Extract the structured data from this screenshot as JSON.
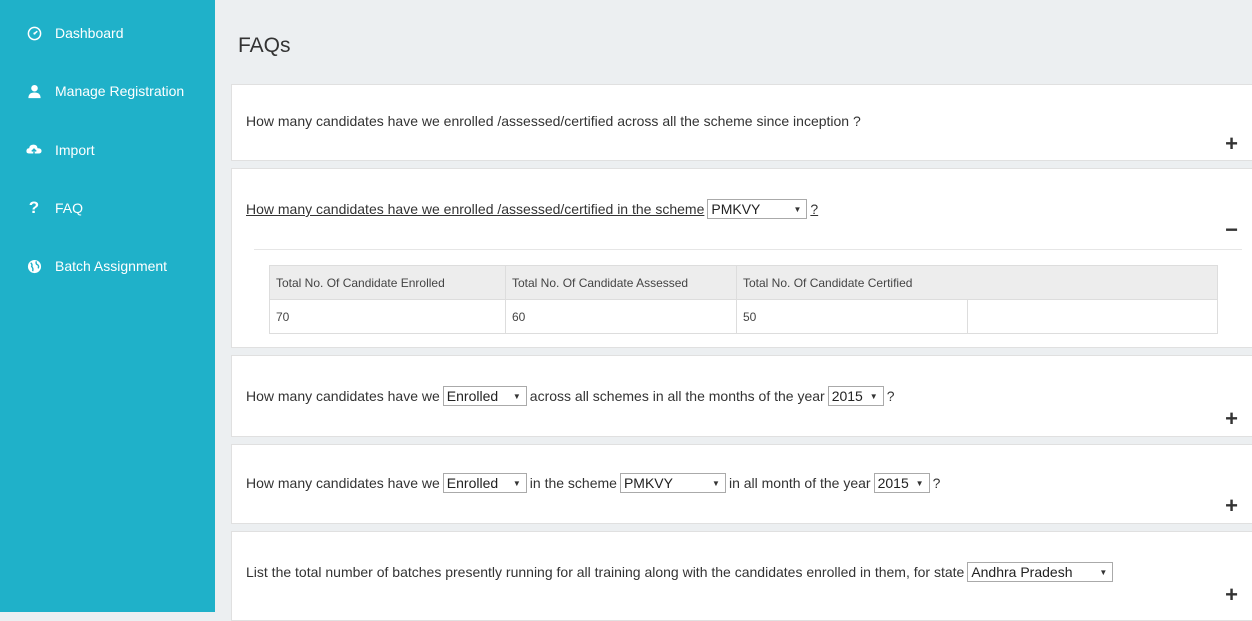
{
  "sidebar": {
    "items": [
      {
        "icon": "dashboard-icon",
        "label": "Dashboard"
      },
      {
        "icon": "user-icon",
        "label": "Manage Registration"
      },
      {
        "icon": "cloud-upload-icon",
        "label": "Import"
      },
      {
        "icon": "question-icon",
        "label": "FAQ"
      },
      {
        "icon": "globe-icon",
        "label": "Batch Assignment"
      }
    ]
  },
  "main": {
    "title": "FAQs",
    "faq1": {
      "text": "How many candidates have we enrolled /assessed/certified across all the scheme since inception ?",
      "toggle": "+"
    },
    "faq2": {
      "text": "How many candidates have we enrolled /assessed/certified in the scheme",
      "scheme": "PMKVY",
      "suffix": "?",
      "toggle": "−",
      "table": {
        "headers": [
          "Total No. Of Candidate Enrolled",
          "Total No. Of Candidate Assessed",
          "Total No. Of Candidate Certified"
        ],
        "values": [
          "70",
          "60",
          "50"
        ]
      }
    },
    "faq3": {
      "part1": "How many candidates have we",
      "status": "Enrolled",
      "part2": "across all schemes in all the months of the year",
      "year": "2015",
      "suffix": "?",
      "toggle": "+"
    },
    "faq4": {
      "part1": "How many candidates have we",
      "status": "Enrolled",
      "part2": "in the scheme",
      "scheme": "PMKVY",
      "part3": "in all month of the year",
      "year": "2015",
      "suffix": "?",
      "toggle": "+"
    },
    "faq5": {
      "part1": "List the total number of batches presently running for all training along with the candidates enrolled in them, for state",
      "state": "Andhra Pradesh",
      "toggle": "+"
    }
  }
}
